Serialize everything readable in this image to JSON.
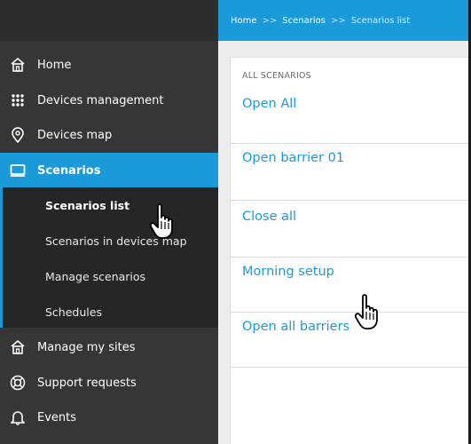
{
  "breadcrumb": {
    "home": "Home",
    "separator": ">>",
    "scenarios": "Scenarios",
    "current": "Scenarios list"
  },
  "sidebar": {
    "items": [
      {
        "label": "Home",
        "icon": "home-icon"
      },
      {
        "label": "Devices management",
        "icon": "grid-icon"
      },
      {
        "label": "Devices map",
        "icon": "map-pin-icon"
      },
      {
        "label": "Scenarios",
        "icon": "monitor-icon"
      },
      {
        "label": "Manage my sites",
        "icon": "home-icon"
      },
      {
        "label": "Support requests",
        "icon": "lifebuoy-icon"
      },
      {
        "label": "Events",
        "icon": "bell-icon"
      }
    ],
    "submenu": [
      {
        "label": "Scenarios list"
      },
      {
        "label": "Scenarios in devices map"
      },
      {
        "label": "Manage scenarios"
      },
      {
        "label": "Schedules"
      }
    ],
    "active_color": "#1a9ad9"
  },
  "main": {
    "header": "ALL SCENARIOS",
    "scenarios": [
      {
        "label": "Open All"
      },
      {
        "label": "Open barrier 01"
      },
      {
        "label": "Close all"
      },
      {
        "label": "Morning setup"
      },
      {
        "label": "Open all barriers"
      }
    ]
  },
  "colors": {
    "accent": "#1a9ad9",
    "sidebar_bg": "#363636",
    "submenu_bg": "#262626",
    "link": "#1a9ad9"
  }
}
